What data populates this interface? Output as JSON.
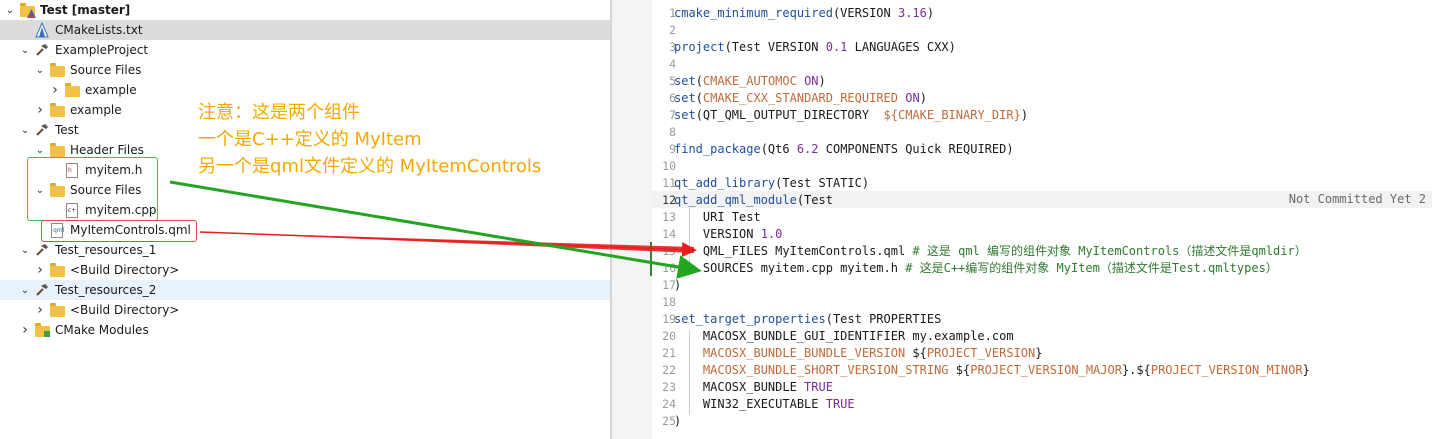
{
  "tree": {
    "items": [
      {
        "label": "Test [master]",
        "indent": 0,
        "arrow": "down",
        "icon": "cmake-project-icon",
        "bold": true
      },
      {
        "label": "CMakeLists.txt",
        "indent": 1,
        "arrow": "",
        "icon": "cmake-file-icon",
        "selected": true
      },
      {
        "label": "ExampleProject",
        "indent": 1,
        "arrow": "down",
        "icon": "hammer-icon"
      },
      {
        "label": "Source Files",
        "indent": 2,
        "arrow": "down",
        "icon": "folder-icon"
      },
      {
        "label": "example",
        "indent": 3,
        "arrow": "right",
        "icon": "folder-icon"
      },
      {
        "label": "example",
        "indent": 2,
        "arrow": "right",
        "icon": "folder-icon"
      },
      {
        "label": "Test",
        "indent": 1,
        "arrow": "down",
        "icon": "hammer-icon"
      },
      {
        "label": "Header Files",
        "indent": 2,
        "arrow": "down",
        "icon": "folder-icon"
      },
      {
        "label": "myitem.h",
        "indent": 3,
        "arrow": "",
        "icon": "header-file-icon"
      },
      {
        "label": "Source Files",
        "indent": 2,
        "arrow": "down",
        "icon": "folder-icon"
      },
      {
        "label": "myitem.cpp",
        "indent": 3,
        "arrow": "",
        "icon": "cpp-file-icon"
      },
      {
        "label": "MyItemControls.qml",
        "indent": 2,
        "arrow": "",
        "icon": "qml-file-icon"
      },
      {
        "label": "Test_resources_1",
        "indent": 1,
        "arrow": "down",
        "icon": "hammer-icon"
      },
      {
        "label": "<Build Directory>",
        "indent": 2,
        "arrow": "right",
        "icon": "folder-icon"
      },
      {
        "label": "Test_resources_2",
        "indent": 1,
        "arrow": "down",
        "icon": "hammer-icon",
        "hover": true
      },
      {
        "label": "<Build Directory>",
        "indent": 2,
        "arrow": "right",
        "icon": "folder-icon"
      },
      {
        "label": "CMake Modules",
        "indent": 1,
        "arrow": "right",
        "icon": "cmake-modules-icon"
      }
    ]
  },
  "annotation": {
    "line1": "注意：这是两个组件",
    "line2": "一个是C++定义的 MyItem",
    "line3": "另一个是qml文件定义的 MyItemControls",
    "color": "#f5a800"
  },
  "editor": {
    "current_line": 12,
    "blame_text": "Not Committed Yet 2",
    "lines": [
      {
        "n": "1",
        "segs": [
          [
            "fn",
            "cmake_minimum_required"
          ],
          [
            "",
            "(VERSION "
          ],
          [
            "num",
            "3.16"
          ],
          [
            "",
            ")"
          ]
        ]
      },
      {
        "n": "2",
        "segs": []
      },
      {
        "n": "3",
        "segs": [
          [
            "fn",
            "project"
          ],
          [
            "",
            "(Test VERSION "
          ],
          [
            "num",
            "0.1"
          ],
          [
            "",
            " LANGUAGES CXX)"
          ]
        ]
      },
      {
        "n": "4",
        "segs": []
      },
      {
        "n": "5",
        "segs": [
          [
            "fn",
            "set"
          ],
          [
            "",
            "("
          ],
          [
            "var",
            "CMAKE_AUTOMOC"
          ],
          [
            "kw",
            " ON"
          ],
          [
            "",
            ")"
          ]
        ]
      },
      {
        "n": "6",
        "segs": [
          [
            "fn",
            "set"
          ],
          [
            "",
            "("
          ],
          [
            "var",
            "CMAKE_CXX_STANDARD_REQUIRED"
          ],
          [
            "kw",
            " ON"
          ],
          [
            "",
            ")"
          ]
        ]
      },
      {
        "n": "7",
        "segs": [
          [
            "fn",
            "set"
          ],
          [
            "",
            "(QT_QML_OUTPUT_DIRECTORY  "
          ],
          [
            "var",
            "${CMAKE_BINARY_DIR}"
          ],
          [
            "",
            ")"
          ]
        ]
      },
      {
        "n": "8",
        "segs": []
      },
      {
        "n": "9",
        "segs": [
          [
            "fn",
            "find_package"
          ],
          [
            "",
            "(Qt6 "
          ],
          [
            "num",
            "6.2"
          ],
          [
            "",
            " COMPONENTS Quick REQUIRED)"
          ]
        ]
      },
      {
        "n": "10",
        "segs": []
      },
      {
        "n": "11",
        "segs": [
          [
            "fn",
            "qt_add_library"
          ],
          [
            "",
            "(Test STATIC)"
          ]
        ]
      },
      {
        "n": "12",
        "segs": [
          [
            "fn",
            "qt_add_qml_module"
          ],
          [
            "",
            "(Test"
          ]
        ]
      },
      {
        "n": "13",
        "segs": [
          [
            "",
            "    URI Test"
          ]
        ]
      },
      {
        "n": "14",
        "segs": [
          [
            "",
            "    VERSION "
          ],
          [
            "num",
            "1.0"
          ]
        ]
      },
      {
        "n": "15",
        "segs": [
          [
            "",
            "    QML_FILES MyItemControls.qml "
          ],
          [
            "cmt",
            "# 这是 qml 编写的组件对象 MyItemControls（描述文件是qmldir）"
          ]
        ]
      },
      {
        "n": "16",
        "segs": [
          [
            "",
            "    SOURCES myitem.cpp myitem.h "
          ],
          [
            "cmt",
            "# 这是C++编写的组件对象 MyItem（描述文件是Test.qmltypes）"
          ]
        ]
      },
      {
        "n": "17",
        "segs": [
          [
            "",
            ")"
          ]
        ]
      },
      {
        "n": "18",
        "segs": []
      },
      {
        "n": "19",
        "segs": [
          [
            "fn",
            "set_target_properties"
          ],
          [
            "",
            "(Test PROPERTIES"
          ]
        ]
      },
      {
        "n": "20",
        "segs": [
          [
            "",
            "    MACOSX_BUNDLE_GUI_IDENTIFIER my.example.com"
          ]
        ]
      },
      {
        "n": "21",
        "segs": [
          [
            "var",
            "    MACOSX_BUNDLE_BUNDLE_VERSION"
          ],
          [
            "",
            " ${"
          ],
          [
            "var",
            "PROJECT_VERSION"
          ],
          [
            "",
            "}"
          ]
        ]
      },
      {
        "n": "22",
        "segs": [
          [
            "var",
            "    MACOSX_BUNDLE_SHORT_VERSION_STRING"
          ],
          [
            "",
            " ${"
          ],
          [
            "var",
            "PROJECT_VERSION_MAJOR"
          ],
          [
            "",
            "}.${"
          ],
          [
            "var",
            "PROJECT_VERSION_MINOR"
          ],
          [
            "",
            "}"
          ]
        ]
      },
      {
        "n": "23",
        "segs": [
          [
            "",
            "    MACOSX_BUNDLE "
          ],
          [
            "kw",
            "TRUE"
          ]
        ]
      },
      {
        "n": "24",
        "segs": [
          [
            "",
            "    WIN32_EXECUTABLE "
          ],
          [
            "kw",
            "TRUE"
          ]
        ]
      },
      {
        "n": "25",
        "segs": [
          [
            "",
            ")"
          ]
        ]
      }
    ]
  }
}
